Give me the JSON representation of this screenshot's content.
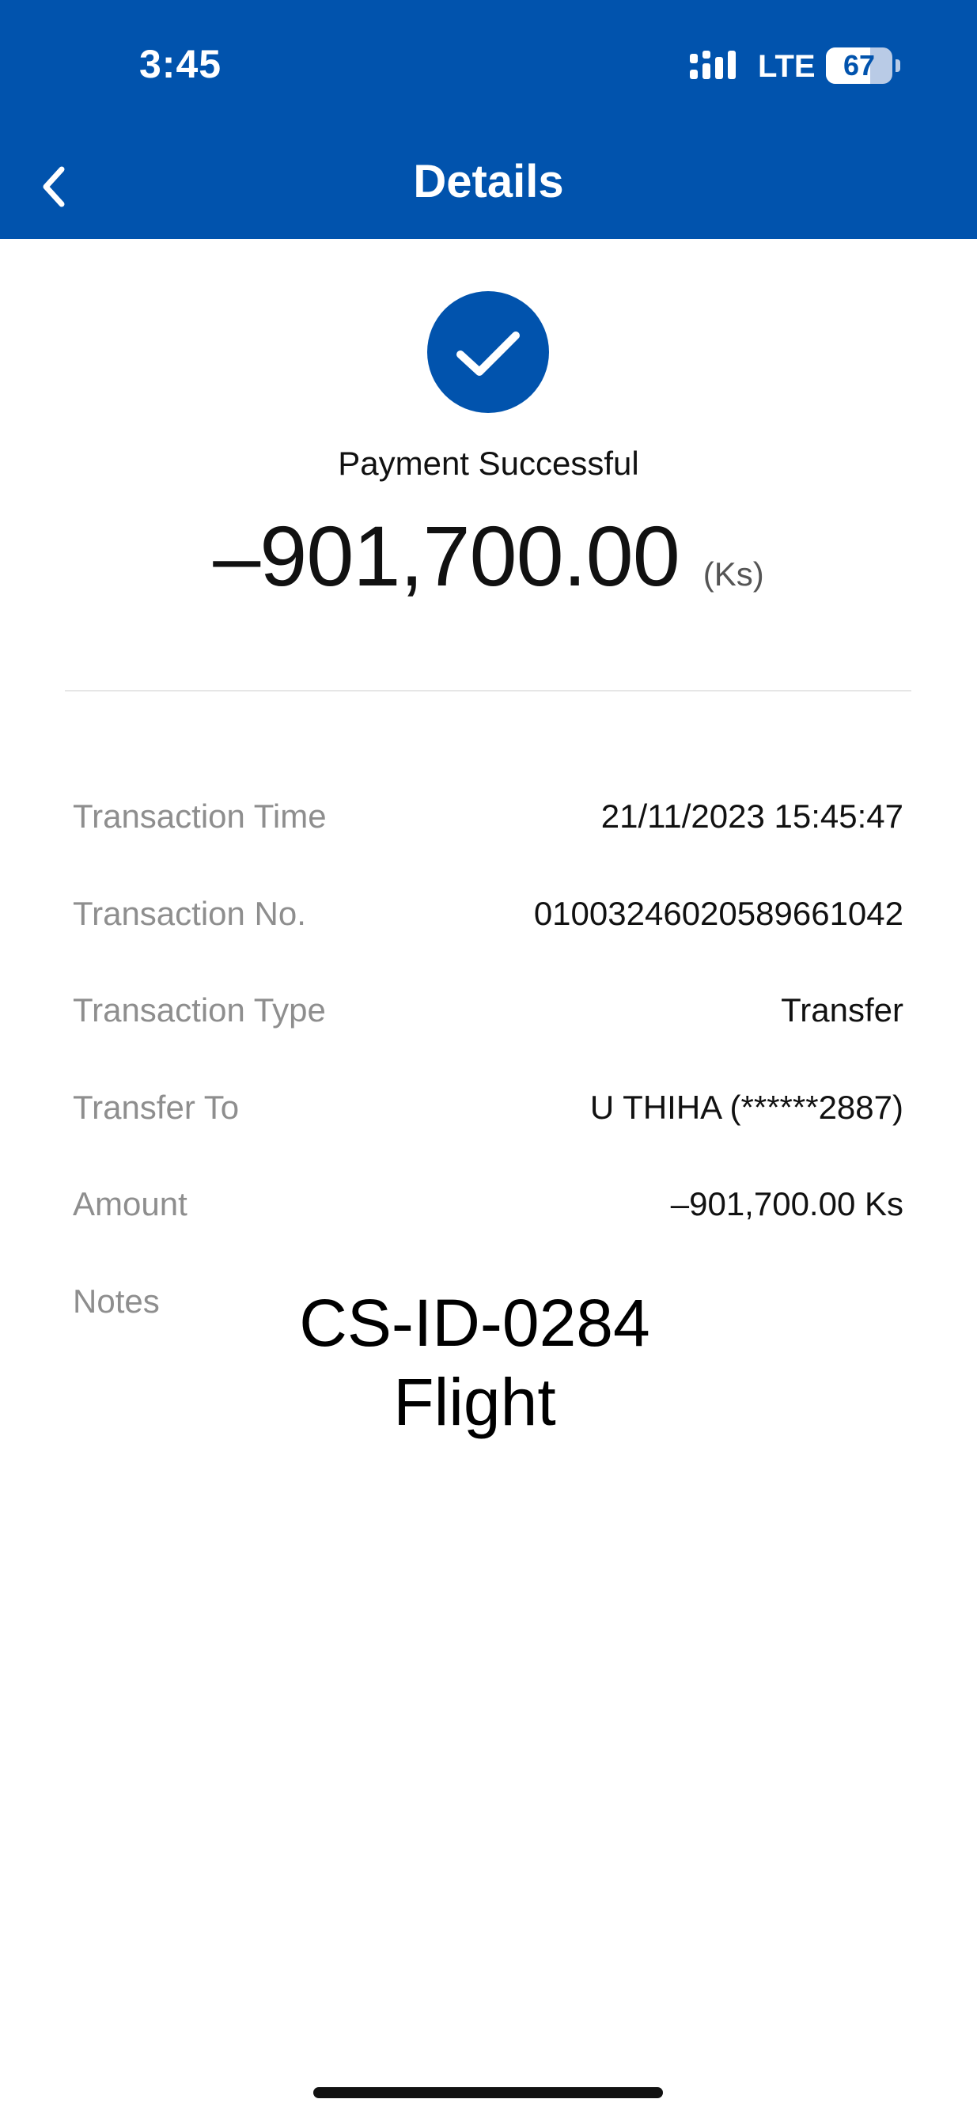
{
  "status_bar": {
    "time": "3:45",
    "network": "LTE",
    "battery_level": "67",
    "battery_fraction": 0.67
  },
  "nav": {
    "title": "Details",
    "back_icon": "chevron-left-icon"
  },
  "summary": {
    "icon": "check-circle-icon",
    "status": "Payment Successful",
    "amount": "–901,700.00",
    "unit": "(Ks)"
  },
  "details": {
    "transaction_time": {
      "label": "Transaction Time",
      "value": "21/11/2023 15:45:47"
    },
    "transaction_no": {
      "label": "Transaction No.",
      "value": "01003246020589661042"
    },
    "transaction_type": {
      "label": "Transaction Type",
      "value": "Transfer"
    },
    "transfer_to": {
      "label": "Transfer To",
      "value": "U THIHA (******2887)"
    },
    "amount": {
      "label": "Amount",
      "value": "–901,700.00 Ks"
    },
    "notes": {
      "label": "Notes",
      "line1": "CS-ID-0284",
      "line2": "Flight"
    }
  },
  "colors": {
    "brand": "#0153ad",
    "label": "#8e8e8e",
    "text": "#111111"
  }
}
